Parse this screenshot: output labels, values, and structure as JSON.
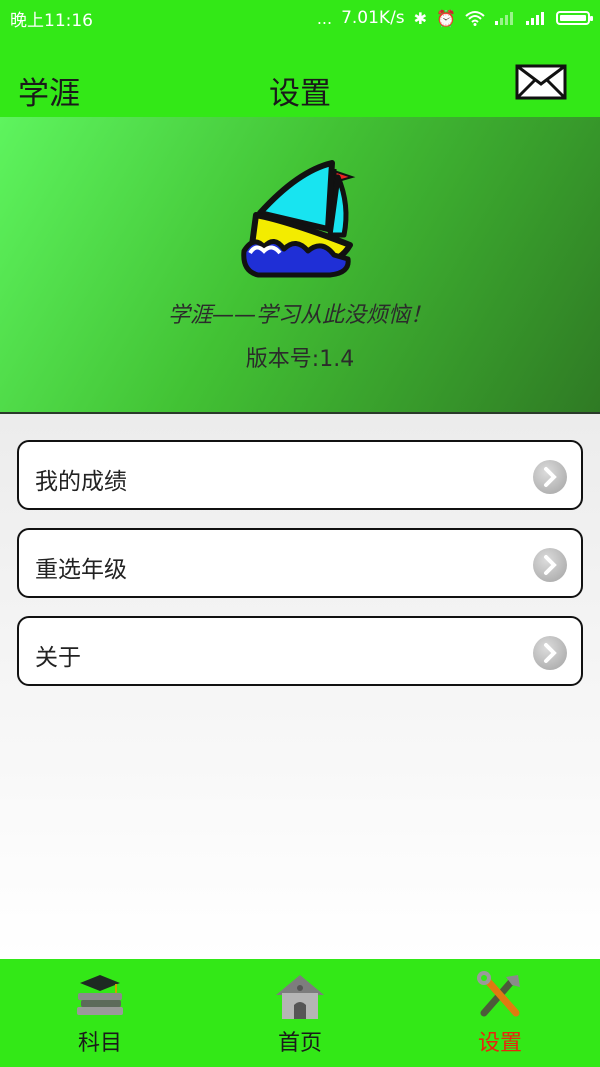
{
  "status_bar": {
    "time": "晚上11:16",
    "dots": "...",
    "network_speed": "7.01K/s",
    "icons": [
      "bluetooth-icon",
      "alarm-icon",
      "wifi-icon",
      "signal-icon",
      "signal-icon",
      "battery-icon"
    ]
  },
  "header": {
    "app_name": "学涯",
    "title": "设置",
    "mail_icon": "mail-icon"
  },
  "banner": {
    "logo": "sailboat-logo",
    "slogan": "学涯——学习从此没烦恼！",
    "version": "版本号:1.4"
  },
  "menu": {
    "items": [
      {
        "label": "我的成绩",
        "icon": "chevron-right-icon"
      },
      {
        "label": "重选年级",
        "icon": "chevron-right-icon"
      },
      {
        "label": "关于",
        "icon": "chevron-right-icon"
      }
    ]
  },
  "tabs": [
    {
      "label": "科目",
      "icon": "books-icon",
      "active": false
    },
    {
      "label": "首页",
      "icon": "house-icon",
      "active": false
    },
    {
      "label": "设置",
      "icon": "tools-icon",
      "active": true
    }
  ],
  "colors": {
    "bar_green": "#33e817",
    "active_tab": "#e8260e"
  }
}
